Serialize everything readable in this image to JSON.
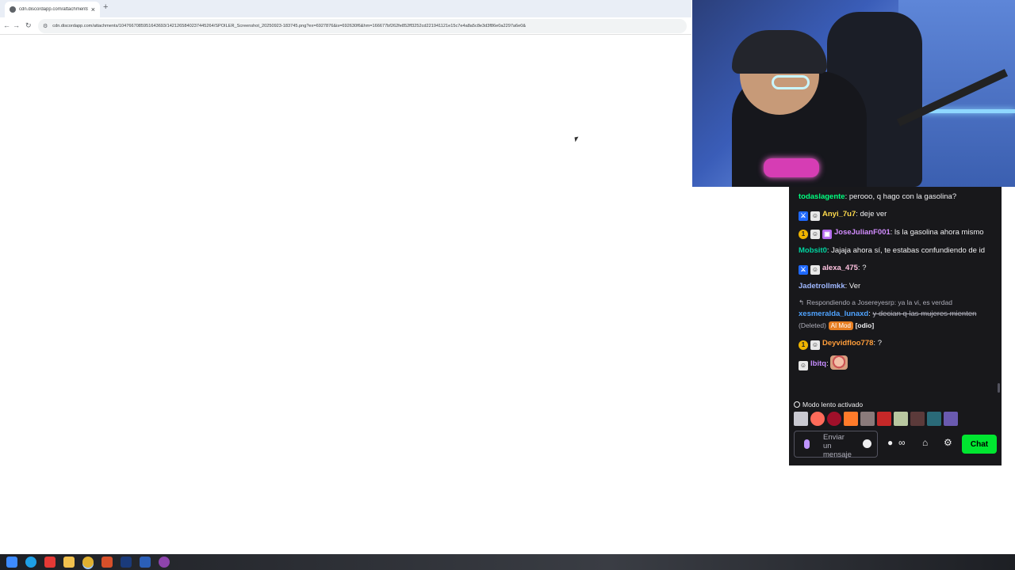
{
  "browser": {
    "tab_title": "cdn.discordapp.com/attachments/",
    "tab_close": "×",
    "new_tab": "+",
    "back": "←",
    "forward": "→",
    "reload": "↻",
    "url": "cdn.discordapp.com/attachments/1047667085951643693/1421265840237445264/SPOILER_Screenshot_20250923-183745.png?ex=6927876&is=692630f6&hm=166677bf262fe852ff3252cd221941121e15c7e4a8a5c8e3d3f86e0a2297a6e0&"
  },
  "chat": {
    "messages": [
      {
        "badges": [],
        "user": "todaslagente",
        "user_color": "#00ff7f",
        "text": ": perooo, q hago con la gasolina?"
      },
      {
        "badges": [
          "mod",
          "sub"
        ],
        "user": "Anyi_7u7",
        "user_color": "#ffdb4d",
        "text": ": deje ver"
      },
      {
        "badges": [
          "gold",
          "sub",
          "gift"
        ],
        "user": "JoseJulianF001",
        "user_color": "#d28cff",
        "text": ": ls la gasolina ahora mismo"
      },
      {
        "badges": [],
        "user": "Mobsit0",
        "user_color": "#00d4a0",
        "text": ": Jajaja ahora sí, te estabas confundiendo de id"
      },
      {
        "badges": [
          "mod",
          "sub"
        ],
        "user": "alexa_475",
        "user_color": "#ffc2e0",
        "text": ": ?"
      },
      {
        "badges": [],
        "user": "Jadetrollmkk",
        "user_color": "#9fb8ff",
        "text": ": Ver"
      },
      {
        "badges": [
          "gold",
          "sub"
        ],
        "user": "Deyvidfloo778",
        "user_color": "#ff9d3a",
        "text": ": ?"
      },
      {
        "badges": [
          "sub"
        ],
        "user": "lbitq",
        "user_color": "#c58cff",
        "text": ": "
      }
    ],
    "reply": {
      "context": "Respondiendo a Josereyesrp: ya la vi, es verdad",
      "user": "xesmeralda_lunaxd",
      "user_color": "#4fa3ff",
      "deleted_text": "y decian q las mujeres mienten",
      "deleted_tag": "(Deleted)",
      "automod": "AI Mod",
      "label": "[odio]"
    },
    "slow_mode": "Modo lento activado",
    "input_placeholder": "Enviar un mensaje",
    "chat_button": "Chat",
    "points_icon": "∞"
  },
  "colors": {
    "chat_bg": "#18181b",
    "chat_button": "#00e630",
    "mod_badge": "#1f69ff"
  }
}
